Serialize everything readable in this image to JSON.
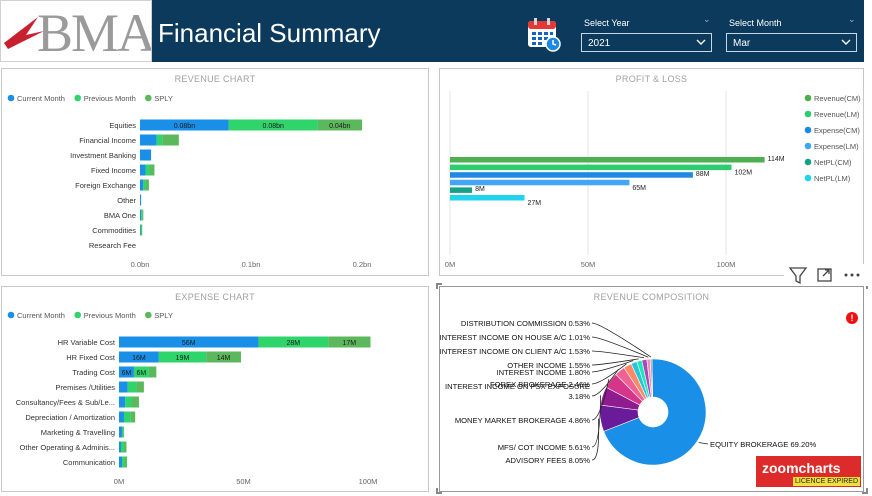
{
  "header": {
    "logo_text": "BMA",
    "title": "Financial Summary",
    "year_label": "Select Year",
    "year_value": "2021",
    "month_label": "Select Month",
    "month_value": "Mar"
  },
  "colors": {
    "header_bg": "#0b3a5c",
    "current_month": "#1a8fe8",
    "previous_month": "#2fd46a",
    "sply": "#5cb85c",
    "revenue_cm": "#4caf50",
    "revenue_lm": "#2ecc71",
    "expense_cm": "#1e88e5",
    "expense_lm": "#42a5f5",
    "netpl_cm": "#16a085",
    "netpl_lm": "#22d3ee"
  },
  "chart_data": [
    {
      "id": "revenue",
      "type": "bar",
      "orientation": "horizontal",
      "stacked": true,
      "title": "REVENUE CHART",
      "categories": [
        "Equities",
        "Financial Income",
        "Investment Banking",
        "Fixed Income",
        "Foreign Exchange",
        "Other",
        "BMA One",
        "Commodities",
        "Research Fee"
      ],
      "series": [
        {
          "name": "Current Month",
          "values": [
            0.08,
            0.015,
            0.01,
            0.005,
            0.003,
            0.001,
            0.001,
            0.0005,
            0
          ]
        },
        {
          "name": "Previous Month",
          "values": [
            0.08,
            0.005,
            0,
            0.004,
            0.002,
            0,
            0.001,
            0.0008,
            0
          ]
        },
        {
          "name": "SPLY",
          "values": [
            0.04,
            0.015,
            0,
            0.004,
            0.003,
            0,
            0.001,
            0.0005,
            0
          ]
        }
      ],
      "data_labels": [
        "0.08bn",
        "0.08bn",
        "0.04bn"
      ],
      "xticks": [
        "0.0bn",
        "0.1bn",
        "0.2bn"
      ],
      "xlim": [
        0,
        0.2
      ],
      "legend": "top-left"
    },
    {
      "id": "profit_loss",
      "type": "bar",
      "orientation": "horizontal",
      "title": "PROFIT & LOSS",
      "categories": [
        ""
      ],
      "series": [
        {
          "name": "Revenue(CM)",
          "values": [
            114
          ]
        },
        {
          "name": "Revenue(LM)",
          "values": [
            102
          ]
        },
        {
          "name": "Expense(CM)",
          "values": [
            88
          ]
        },
        {
          "name": "Expense(LM)",
          "values": [
            65
          ]
        },
        {
          "name": "NetPL(CM)",
          "values": [
            8
          ]
        },
        {
          "name": "NetPL(LM)",
          "values": [
            27
          ]
        }
      ],
      "data_labels": [
        "114M",
        "102M",
        "88M",
        "65M",
        "8M",
        "27M"
      ],
      "xticks": [
        "0M",
        "50M",
        "100M"
      ],
      "xlim": [
        0,
        100
      ],
      "legend": "right"
    },
    {
      "id": "expense",
      "type": "bar",
      "orientation": "horizontal",
      "stacked": true,
      "title": "EXPENSE CHART",
      "categories": [
        "HR Variable Cost",
        "HR Fixed Cost",
        "Trading Cost",
        "Premises /Utilities",
        "Consultancy/Fees & Sub/Le...",
        "Depreciation / Amortization",
        "Marketing & Travelling",
        "Other Operating & Adminis...",
        "Communication"
      ],
      "series": [
        {
          "name": "Current Month",
          "values": [
            56,
            16,
            6,
            3.5,
            2.5,
            2,
            1.2,
            0.8,
            1.2
          ]
        },
        {
          "name": "Previous Month",
          "values": [
            28,
            19,
            6,
            3.5,
            2.5,
            2.5,
            0.5,
            1.2,
            1.2
          ]
        },
        {
          "name": "SPLY",
          "values": [
            17,
            14,
            3,
            3,
            3,
            2,
            0.3,
            1,
            0.8
          ]
        }
      ],
      "data_labels": [
        "56M",
        "28M",
        "17M",
        "16M",
        "19M",
        "14M",
        "6M",
        "6M"
      ],
      "xticks": [
        "0M",
        "50M",
        "100M"
      ],
      "xlim": [
        0,
        100
      ],
      "legend": "top-left"
    },
    {
      "id": "revenue_composition",
      "type": "pie",
      "donut": true,
      "title": "REVENUE COMPOSITION",
      "slices": [
        {
          "label": "EQUITY BROKERAGE",
          "pct_text": "69.20%",
          "value": 69.2,
          "color": "#1a8fe8"
        },
        {
          "label": "ADVISORY FEES",
          "pct_text": "8.05%",
          "value": 8.05,
          "color": "#6a1b9a"
        },
        {
          "label": "MFS/ COT INCOME",
          "pct_text": "5.61%",
          "value": 5.61,
          "color": "#8e1c8e"
        },
        {
          "label": "MONEY MARKET BROKERAGE",
          "pct_text": "4.86%",
          "value": 4.86,
          "color": "#d6368a"
        },
        {
          "label": "INTEREST INCOME ON PSX EXPOSURE",
          "pct_text": "3.18%",
          "value": 3.18,
          "color": "#f06292"
        },
        {
          "label": "FOREX BROKERAGE",
          "pct_text": "2.46%",
          "value": 2.46,
          "color": "#ff8a65"
        },
        {
          "label": "INTEREST INCOME",
          "pct_text": "1.80%",
          "value": 1.8,
          "color": "#26c6da"
        },
        {
          "label": "OTHER INCOME",
          "pct_text": "1.55%",
          "value": 1.55,
          "color": "#1de9b6"
        },
        {
          "label": "INTEREST INCOME ON CLIENT A/C",
          "pct_text": "1.53%",
          "value": 1.53,
          "color": "#ab47bc"
        },
        {
          "label": "INTEREST INCOME ON HOUSE A/C",
          "pct_text": "1.01%",
          "value": 1.01,
          "color": "#f48fb1"
        },
        {
          "label": "DISTRIBUTION COMMISSION",
          "pct_text": "0.53%",
          "value": 0.53,
          "color": "#90a4ae"
        }
      ]
    }
  ],
  "watermark": {
    "name": "zoomcharts",
    "badge": "LICENCE EXPIRED"
  },
  "info_icon_text": "!"
}
